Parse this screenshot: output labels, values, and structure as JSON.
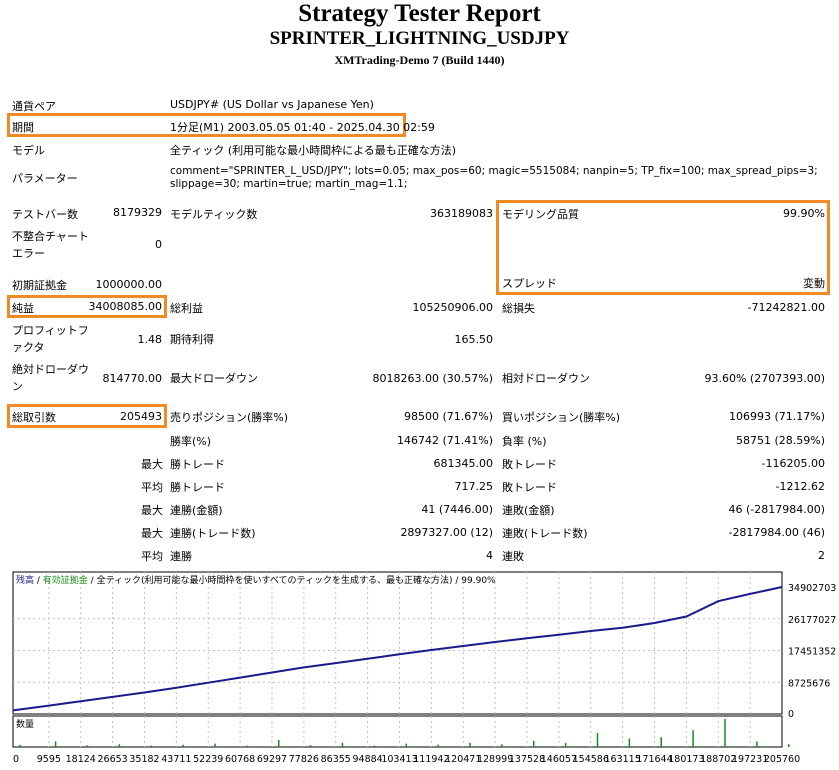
{
  "header": {
    "title": "Strategy Tester Report",
    "subtitle": "SPRINTER_LIGHTNING_USDJPY",
    "server": "XMTrading-Demo 7 (Build 1440)"
  },
  "settings": {
    "symbol_label": "通貨ペア",
    "symbol_value": "USDJPY# (US Dollar vs Japanese Yen)",
    "period_label": "期間",
    "period_value": "1分足(M1) 2003.05.05 01:40 - 2025.04.30 02:59",
    "model_label": "モデル",
    "model_value": "全ティック (利用可能な最小時間枠による最も正確な方法)",
    "params_label": "パラメーター",
    "params_line1": "comment=\"SPRINTER_L_USD/JPY\"; lots=0.05; max_pos=60; magic=5515084; nanpin=5; TP_fix=100; max_spread_pips=3;",
    "params_line2": "slippage=30; martin=true; martin_mag=1.1;"
  },
  "stats": {
    "bars_label": "テストバー数",
    "bars_value": "8179329",
    "ticks_label": "モデルティック数",
    "ticks_value": "363189083",
    "quality_label": "モデリング品質",
    "quality_value": "99.90%",
    "mismatch_label1": "不整合チャート",
    "mismatch_label2": "エラー",
    "mismatch_value": "0",
    "deposit_label": "初期証拠金",
    "deposit_value": "1000000.00",
    "spread_label": "スプレッド",
    "spread_value": "変動",
    "net_label": "純益",
    "net_value": "34008085.00",
    "gross_profit_label": "総利益",
    "gross_profit_value": "105250906.00",
    "gross_loss_label": "総損失",
    "gross_loss_value": "-71242821.00",
    "pf_label1": "プロフィットフ",
    "pf_label2": "ァクタ",
    "pf_value": "1.48",
    "payoff_label": "期待利得",
    "payoff_value": "165.50",
    "abs_dd_label1": "絶対ドローダウ",
    "abs_dd_label2": "ン",
    "abs_dd_value": "814770.00",
    "max_dd_label": "最大ドローダウン",
    "max_dd_value": "8018263.00 (30.57%)",
    "rel_dd_label": "相対ドローダウン",
    "rel_dd_value": "93.60% (2707393.00)",
    "trades_label": "総取引数",
    "trades_value": "205493",
    "short_label": "売りポジション(勝率%)",
    "short_value": "98500 (71.67%)",
    "long_label": "買いポジション(勝率%)",
    "long_value": "106993 (71.17%)",
    "win_label": "勝率(%)",
    "win_value": "146742 (71.41%)",
    "loss_label": "負率 (%)",
    "loss_value": "58751 (28.59%)",
    "max_word": "最大",
    "avg_word": "平均",
    "max_win_label": "勝トレード",
    "max_win_value": "681345.00",
    "max_loss_label": "敗トレード",
    "max_loss_value": "-116205.00",
    "avg_win_label": "勝トレード",
    "avg_win_value": "717.25",
    "avg_loss_label": "敗トレード",
    "avg_loss_value": "-1212.62",
    "consec_win_money_label": "連勝(金額)",
    "consec_win_money_value": "41 (7446.00)",
    "consec_loss_money_label": "連敗(金額)",
    "consec_loss_money_value": "46 (-2817984.00)",
    "consec_win_count_label": "連勝(トレード数)",
    "consec_win_count_value": "2897327.00 (12)",
    "consec_loss_count_label": "連敗(トレード数)",
    "consec_loss_count_value": "-2817984.00 (46)",
    "avg_consec_win_label": "連勝",
    "avg_consec_win_value": "4",
    "avg_consec_loss_label": "連敗",
    "avg_consec_loss_value": "2"
  },
  "chart_legend": {
    "balance": "残高",
    "sep1": " / ",
    "equity": "有効証拠金",
    "sep2": " / ",
    "model": "全ティック(利用可能な最小時間枠を使いすべてのティックを生成する、最も正確な方法)",
    "sep3": " / ",
    "quality": "99.90%",
    "volume": "数量"
  },
  "colors": {
    "balance": "#1a1a8c",
    "equity": "#1a8c1a",
    "volume": "#1a8c1a",
    "highlight": "#f08a24",
    "grid": "#c0c0c0"
  },
  "chart_data": [
    {
      "type": "line",
      "title": "",
      "y_ticks": [
        "34902703",
        "26177027",
        "17451352",
        "8725676",
        "0"
      ],
      "ylim": [
        0,
        34902703
      ],
      "xlim": [
        0,
        205760
      ],
      "grid": true,
      "series": [
        {
          "name": "残高",
          "x": [
            0,
            9595,
            18124,
            26653,
            35182,
            43711,
            52239,
            60768,
            69297,
            77826,
            86355,
            94884,
            103413,
            111942,
            120471,
            128999,
            137528,
            146057,
            154586,
            163115,
            171644,
            180173,
            188702,
            197231,
            205760
          ],
          "y": [
            1000000,
            2300000,
            3500000,
            4700000,
            5900000,
            7200000,
            8600000,
            10000000,
            11400000,
            12800000,
            14000000,
            15200000,
            16400000,
            17600000,
            18700000,
            19800000,
            20800000,
            21800000,
            22800000,
            23700000,
            25000000,
            26800000,
            31000000,
            33000000,
            34900000
          ]
        }
      ]
    },
    {
      "type": "bar",
      "title": "",
      "categories": [
        "0",
        "9595",
        "18124",
        "26653",
        "35182",
        "43711",
        "52239",
        "60768",
        "69297",
        "77826",
        "86355",
        "94884",
        "103413",
        "111942",
        "120471",
        "128999",
        "137528",
        "146057",
        "154586",
        "163115",
        "171644",
        "180173",
        "188702",
        "197231",
        "205760"
      ],
      "series": [
        {
          "name": "数量",
          "values": [
            0.08,
            0.2,
            0.06,
            0.1,
            0.05,
            0.08,
            0.12,
            0.05,
            0.25,
            0.07,
            0.15,
            0.05,
            0.12,
            0.08,
            0.15,
            0.1,
            0.22,
            0.15,
            0.5,
            0.3,
            0.35,
            0.6,
            1.0,
            0.2,
            0.1
          ]
        }
      ]
    }
  ]
}
